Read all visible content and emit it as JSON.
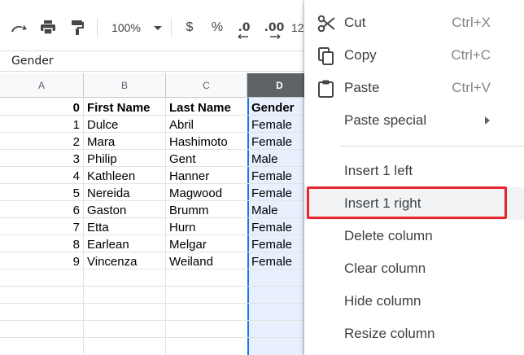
{
  "toolbar": {
    "zoom": "100%",
    "currency": "$",
    "percent": "%",
    "decrease_decimals": ".0",
    "increase_decimals": ".00",
    "more_formats": "12"
  },
  "formula_bar": {
    "value": "Gender"
  },
  "columns": [
    "A",
    "B",
    "C",
    "D"
  ],
  "rows": [
    {
      "n": "0",
      "first": "First Name",
      "last": "Last Name",
      "gender": "Gender"
    },
    {
      "n": "1",
      "first": "Dulce",
      "last": "Abril",
      "gender": "Female"
    },
    {
      "n": "2",
      "first": "Mara",
      "last": "Hashimoto",
      "gender": "Female"
    },
    {
      "n": "3",
      "first": "Philip",
      "last": "Gent",
      "gender": "Male"
    },
    {
      "n": "4",
      "first": "Kathleen",
      "last": "Hanner",
      "gender": "Female"
    },
    {
      "n": "5",
      "first": "Nereida",
      "last": "Magwood",
      "gender": "Female"
    },
    {
      "n": "6",
      "first": "Gaston",
      "last": "Brumm",
      "gender": "Male"
    },
    {
      "n": "7",
      "first": "Etta",
      "last": "Hurn",
      "gender": "Female"
    },
    {
      "n": "8",
      "first": "Earlean",
      "last": "Melgar",
      "gender": "Female"
    },
    {
      "n": "9",
      "first": "Vincenza",
      "last": "Weiland",
      "gender": "Female"
    }
  ],
  "menu": {
    "cut": {
      "label": "Cut",
      "shortcut": "Ctrl+X",
      "icon": "scissors-icon"
    },
    "copy": {
      "label": "Copy",
      "shortcut": "Ctrl+C",
      "icon": "copy-icon"
    },
    "paste": {
      "label": "Paste",
      "shortcut": "Ctrl+V",
      "icon": "clipboard-icon"
    },
    "paste_special": {
      "label": "Paste special"
    },
    "insert_left": {
      "label": "Insert 1 left"
    },
    "insert_right": {
      "label": "Insert 1 right"
    },
    "delete_column": {
      "label": "Delete column"
    },
    "clear_column": {
      "label": "Clear column"
    },
    "hide_column": {
      "label": "Hide column"
    },
    "resize_column": {
      "label": "Resize column"
    }
  },
  "colors": {
    "selected_column_fill": "#e8f0fe",
    "selection_border": "#1a73e8",
    "highlight_box": "#e8262f"
  }
}
